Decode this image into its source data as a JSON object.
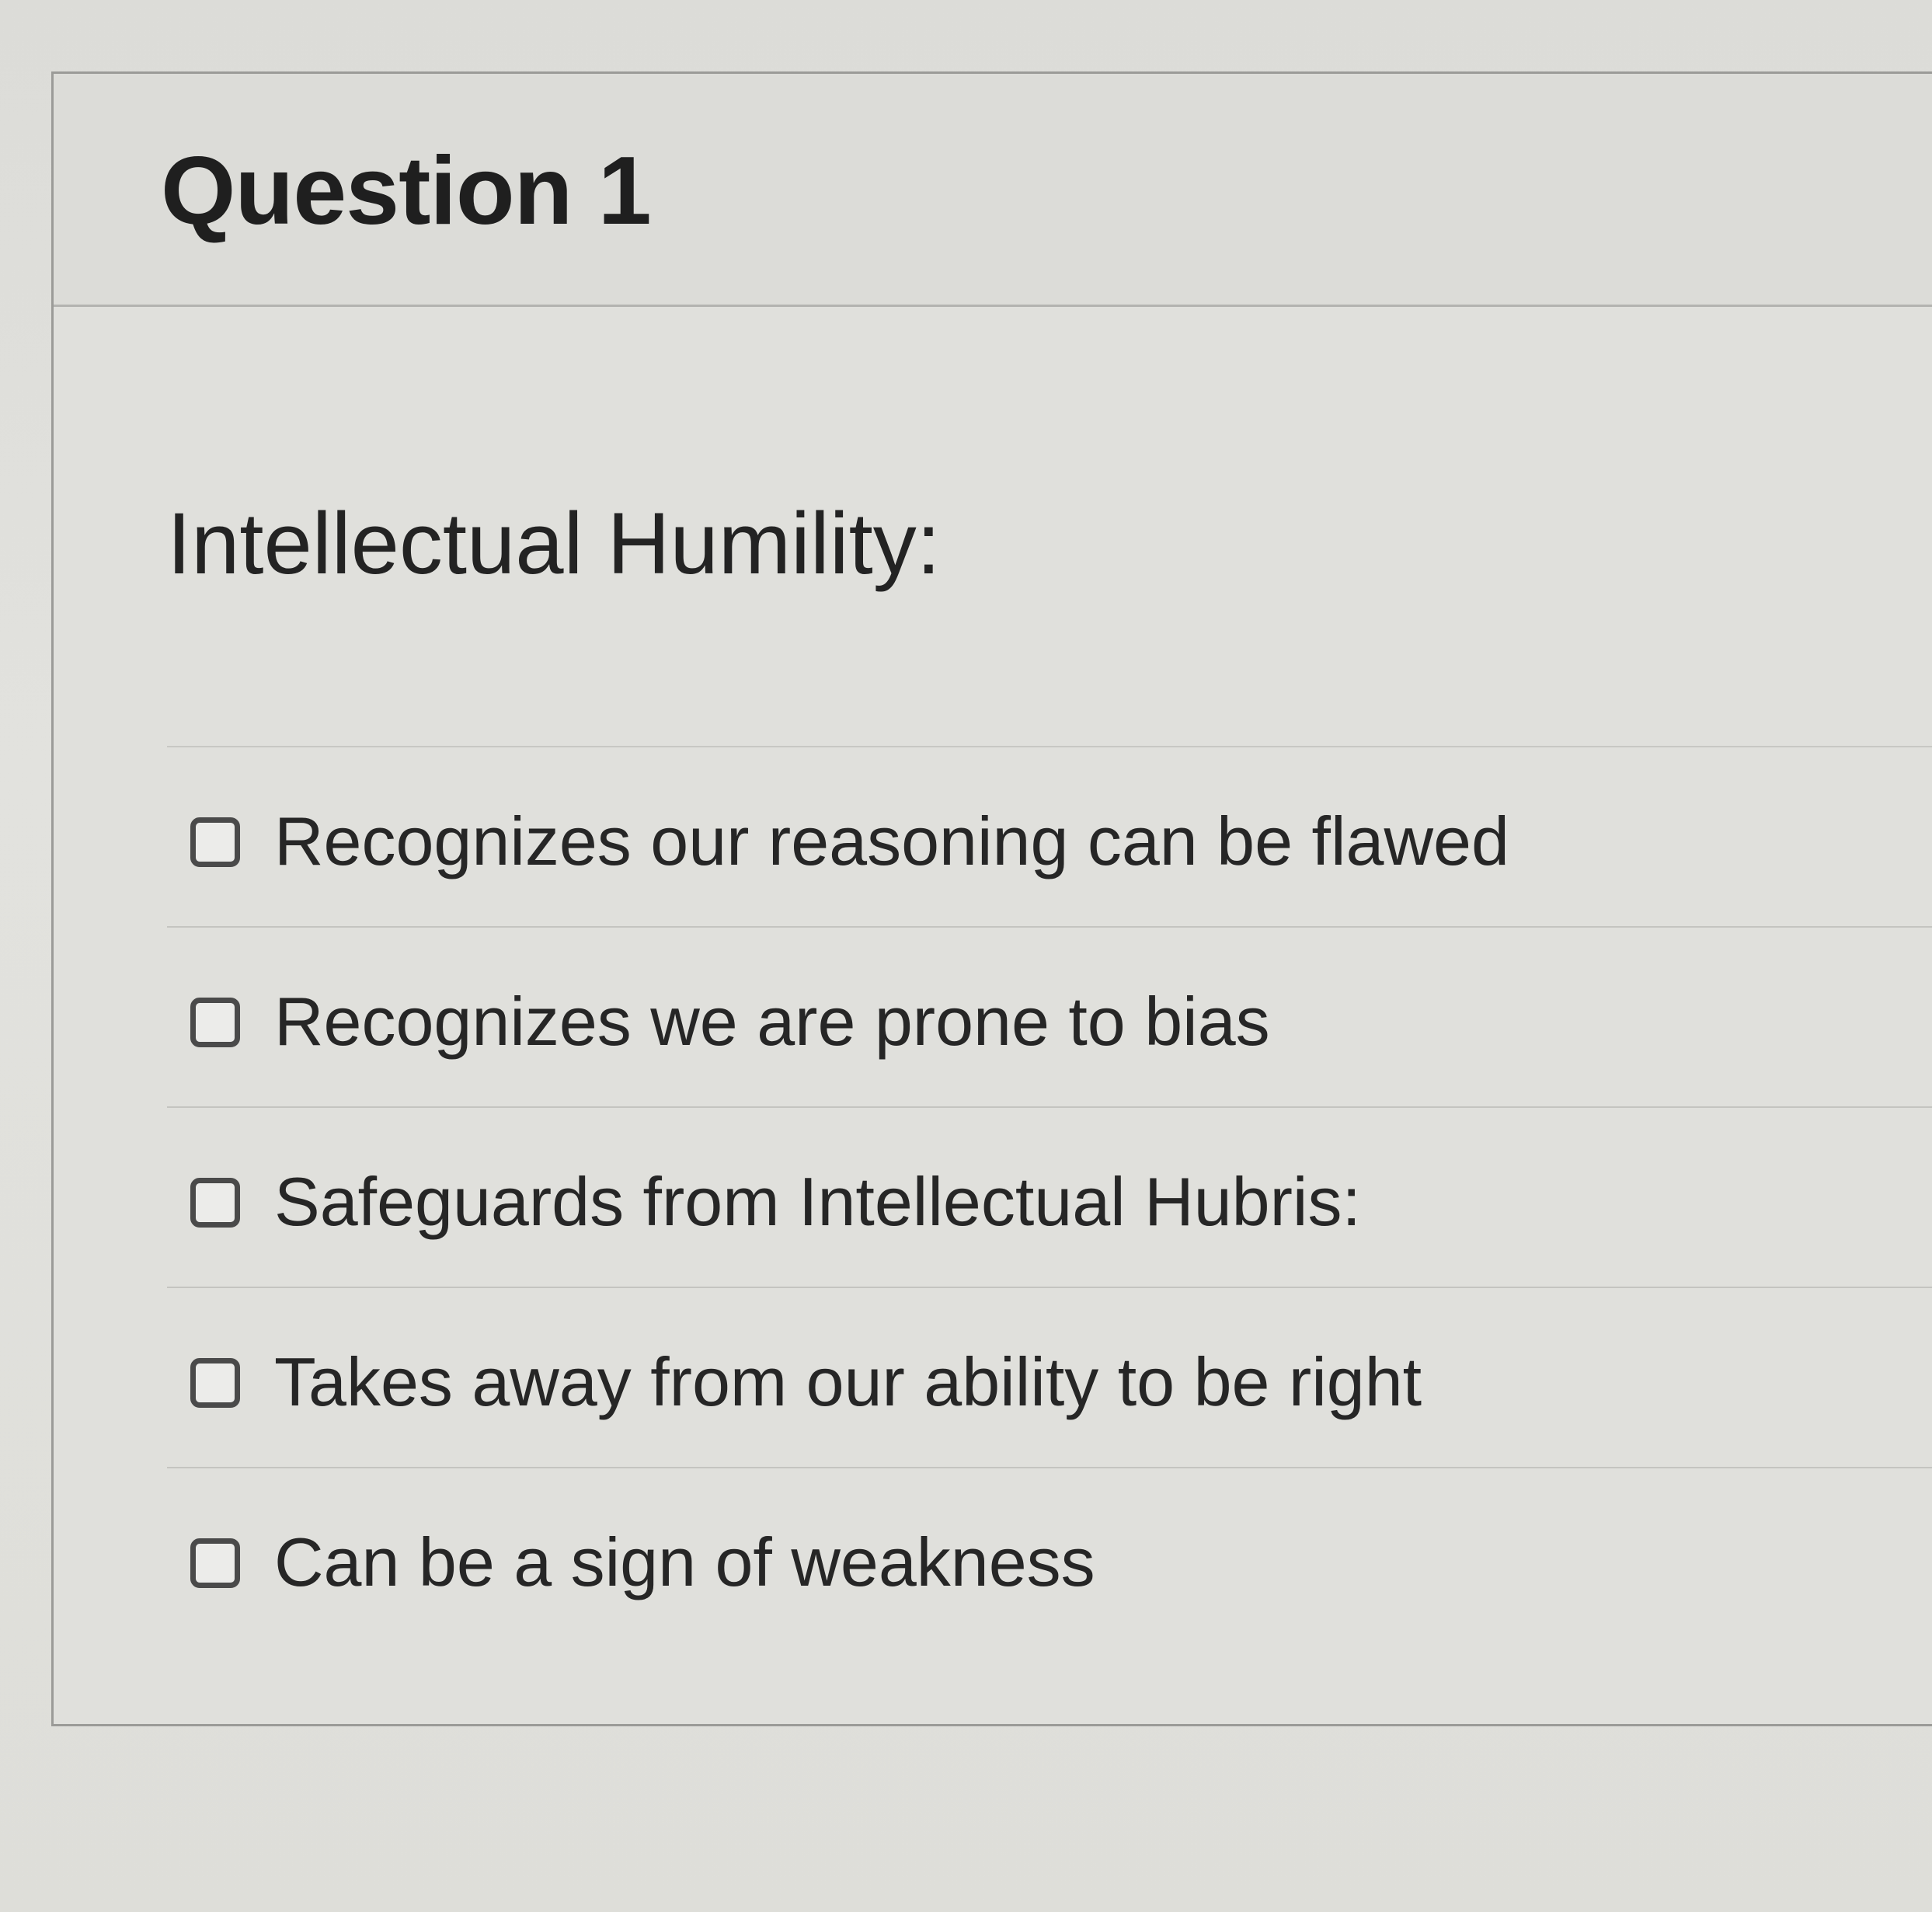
{
  "question": {
    "title": "Question 1",
    "prompt": "Intellectual Humility:",
    "answers": [
      {
        "label": "Recognizes our reasoning can be flawed",
        "checked": false
      },
      {
        "label": "Recognizes we are prone to bias",
        "checked": false
      },
      {
        "label": "Safeguards from Intellectual Hubris:",
        "checked": false
      },
      {
        "label": "Takes away from our ability to be right",
        "checked": false
      },
      {
        "label": "Can be a sign of weakness",
        "checked": false
      }
    ]
  }
}
